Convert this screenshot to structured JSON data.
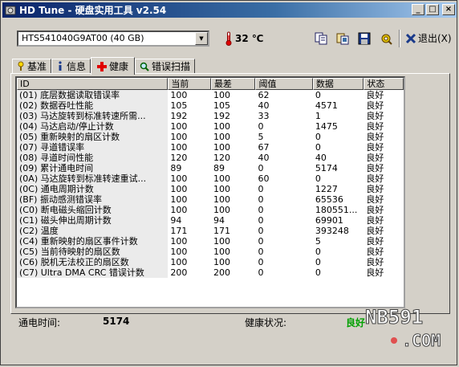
{
  "window": {
    "title": "HD Tune - 硬盘实用工具 v2.54",
    "minimize_glyph": "_",
    "maximize_glyph": "□",
    "close_glyph": "×"
  },
  "toolbar": {
    "drive": "HTS541040G9AT00 (40 GB)",
    "temperature": "32 ℃",
    "exit_label": "退出(X)",
    "icons": [
      "copy-text-icon",
      "copy-screenshot-icon",
      "save-icon",
      "options-icon"
    ]
  },
  "tabs": [
    {
      "label": "基准",
      "icon": "benchmark-icon"
    },
    {
      "label": "信息",
      "icon": "info-icon"
    },
    {
      "label": "健康",
      "icon": "health-cross-icon",
      "active": true
    },
    {
      "label": "错误扫描",
      "icon": "magnifier-icon"
    }
  ],
  "table": {
    "columns": [
      "ID",
      "当前",
      "最差",
      "阈值",
      "数据",
      "状态"
    ],
    "rows": [
      [
        "(01) 底层数据读取错误率",
        "100",
        "100",
        "62",
        "0",
        "良好"
      ],
      [
        "(02) 数据吞吐性能",
        "105",
        "105",
        "40",
        "4571",
        "良好"
      ],
      [
        "(03) 马达旋转到标准转速所需...",
        "192",
        "192",
        "33",
        "1",
        "良好"
      ],
      [
        "(04) 马达启动/停止计数",
        "100",
        "100",
        "0",
        "1475",
        "良好"
      ],
      [
        "(05) 重新映射的扇区计数",
        "100",
        "100",
        "5",
        "0",
        "良好"
      ],
      [
        "(07) 寻道错误率",
        "100",
        "100",
        "67",
        "0",
        "良好"
      ],
      [
        "(08) 寻道时间性能",
        "120",
        "120",
        "40",
        "40",
        "良好"
      ],
      [
        "(09) 累计通电时间",
        "89",
        "89",
        "0",
        "5174",
        "良好"
      ],
      [
        "(0A) 马达旋转到标准转速重试...",
        "100",
        "100",
        "60",
        "0",
        "良好"
      ],
      [
        "(0C) 通电周期计数",
        "100",
        "100",
        "0",
        "1227",
        "良好"
      ],
      [
        "(BF) 振动感测错误率",
        "100",
        "100",
        "0",
        "65536",
        "良好"
      ],
      [
        "(C0) 断电磁头缩回计数",
        "100",
        "100",
        "0",
        "180551...",
        "良好"
      ],
      [
        "(C1) 磁头伸出周期计数",
        "94",
        "94",
        "0",
        "69901",
        "良好"
      ],
      [
        "(C2) 温度",
        "171",
        "171",
        "0",
        "393248",
        "良好"
      ],
      [
        "(C4) 重新映射的扇区事件计数",
        "100",
        "100",
        "0",
        "5",
        "良好"
      ],
      [
        "(C5) 当前待映射的扇区数",
        "100",
        "100",
        "0",
        "0",
        "良好"
      ],
      [
        "(C6) 脱机无法校正的扇区数",
        "100",
        "100",
        "0",
        "0",
        "良好"
      ],
      [
        "(C7) Ultra DMA CRC 错误计数",
        "200",
        "200",
        "0",
        "0",
        "良好"
      ]
    ]
  },
  "status": {
    "power_on_label": "通电时间:",
    "power_on_value": "5174",
    "health_label": "健康状况:",
    "health_value": "良好"
  },
  "watermark": {
    "line1": "NB591",
    "line2": ".COM"
  }
}
